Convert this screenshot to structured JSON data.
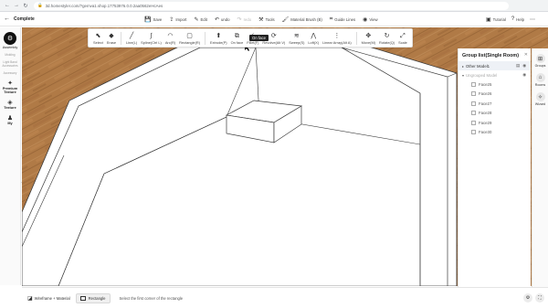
{
  "browser": {
    "url": "3d.homestyler.com/?gemva1.shop.17753976.0.0.2aa0562eHcAes"
  },
  "app": {
    "back_label": "Complete",
    "top_tools": [
      {
        "icon": "save-icon",
        "glyph": "💾",
        "label": "Save",
        "enabled": true
      },
      {
        "icon": "import-icon",
        "glyph": "⇪",
        "label": "Import",
        "enabled": true
      },
      {
        "icon": "edit-icon",
        "glyph": "✎",
        "label": "Edit",
        "enabled": true
      },
      {
        "icon": "undo-icon",
        "glyph": "↶",
        "label": "undo",
        "enabled": true
      },
      {
        "icon": "redo-icon",
        "glyph": "↷",
        "label": "redo",
        "enabled": false
      },
      {
        "icon": "tools-icon",
        "glyph": "⚒",
        "label": "Tools",
        "enabled": true
      },
      {
        "icon": "material-brush-icon",
        "glyph": "🖌",
        "label": "Material Brush (B)",
        "enabled": true
      },
      {
        "icon": "guide-lines-icon",
        "glyph": "⌗",
        "label": "Guide Lines",
        "enabled": true
      },
      {
        "icon": "view-icon",
        "glyph": "◉",
        "label": "View",
        "enabled": true
      }
    ],
    "top_right": [
      {
        "icon": "tutorial-icon",
        "glyph": "▣",
        "label": "Tutorial"
      },
      {
        "icon": "help-icon",
        "glyph": "?",
        "label": "Help"
      },
      {
        "icon": "more-icon",
        "glyph": "⋯",
        "label": ""
      }
    ]
  },
  "sub_tools": {
    "group1": [
      {
        "icon": "select-icon",
        "glyph": "⬉",
        "label": "Select"
      },
      {
        "icon": "erase-icon",
        "glyph": "◆",
        "label": "Erase"
      }
    ],
    "group2": [
      {
        "icon": "line-icon",
        "glyph": "╱",
        "label": "Line(L)"
      },
      {
        "icon": "spline-icon",
        "glyph": "∫",
        "label": "Spline(Ctrl L)"
      },
      {
        "icon": "arc-icon",
        "glyph": "◠",
        "label": "Arc(R)"
      },
      {
        "icon": "rectangle-icon",
        "glyph": "▢",
        "label": "Rectangle(R)"
      }
    ],
    "group3": [
      {
        "icon": "extrude-icon",
        "glyph": "⬆",
        "label": "Extrude(P)"
      },
      {
        "icon": "offset-icon",
        "glyph": "⧉",
        "label": "On face"
      },
      {
        "icon": "fillet-icon",
        "glyph": "◜",
        "label": "Fillet(F)"
      },
      {
        "icon": "revolve-icon",
        "glyph": "⟳",
        "label": "Revolve(Alt V)"
      },
      {
        "icon": "sweep-icon",
        "glyph": "≋",
        "label": "Sweep(S)"
      },
      {
        "icon": "loft-icon",
        "glyph": "⋀",
        "label": "Loft(X)"
      },
      {
        "icon": "linear-array-icon",
        "glyph": "⋮",
        "label": "Linear Array(Alt A)"
      }
    ],
    "group4": [
      {
        "icon": "move-icon",
        "glyph": "✥",
        "label": "Move(M)"
      },
      {
        "icon": "rotate-icon",
        "glyph": "↻",
        "label": "Rotate(Q)"
      },
      {
        "icon": "scale-icon",
        "glyph": "⤢",
        "label": "Scale"
      }
    ],
    "tooltip": "On face"
  },
  "left_sidebar": {
    "logo_glyph": "⚙",
    "logo_label": "Assembly",
    "faint_items": [
      "Molding",
      "Light Band Accessories",
      "Accessory"
    ],
    "items": [
      {
        "icon": "premium-texture-icon",
        "glyph": "✦",
        "label": "Premium Texture"
      },
      {
        "icon": "texture-icon",
        "glyph": "◈",
        "label": "Texture"
      },
      {
        "icon": "my-icon",
        "glyph": "♟",
        "label": "My"
      }
    ],
    "handle_glyph": "›"
  },
  "group_list": {
    "title": "Group list(Single Room)",
    "close_glyph": "✕",
    "other_model": "Other Model1",
    "ungrouped": "Ungrouped Model",
    "faces": [
      "Face25",
      "Face26",
      "Face27",
      "Face28",
      "Face29",
      "Face30"
    ]
  },
  "far_right": [
    {
      "icon": "groups-icon",
      "glyph": "⊞",
      "label": "Groups"
    },
    {
      "icon": "rooms-icon",
      "glyph": "⌂",
      "label": "Rooms"
    },
    {
      "icon": "wizard-icon",
      "glyph": "✧",
      "label": "Wizard"
    }
  ],
  "bottom": {
    "wireframe_label": "Wireframe + Material",
    "rectangle_label": "Rectangle",
    "hint": "Select the first corner of the rectangle",
    "icons": [
      {
        "icon": "settings-icon",
        "glyph": "⚙"
      },
      {
        "icon": "fullscreen-icon",
        "glyph": "⛶"
      }
    ]
  },
  "colors": {
    "floor_wood": "#b07a46",
    "floor_wood_dark": "#8d5c31",
    "wall_line": "#3a3a3a",
    "panel_select": "#eef1f6"
  }
}
